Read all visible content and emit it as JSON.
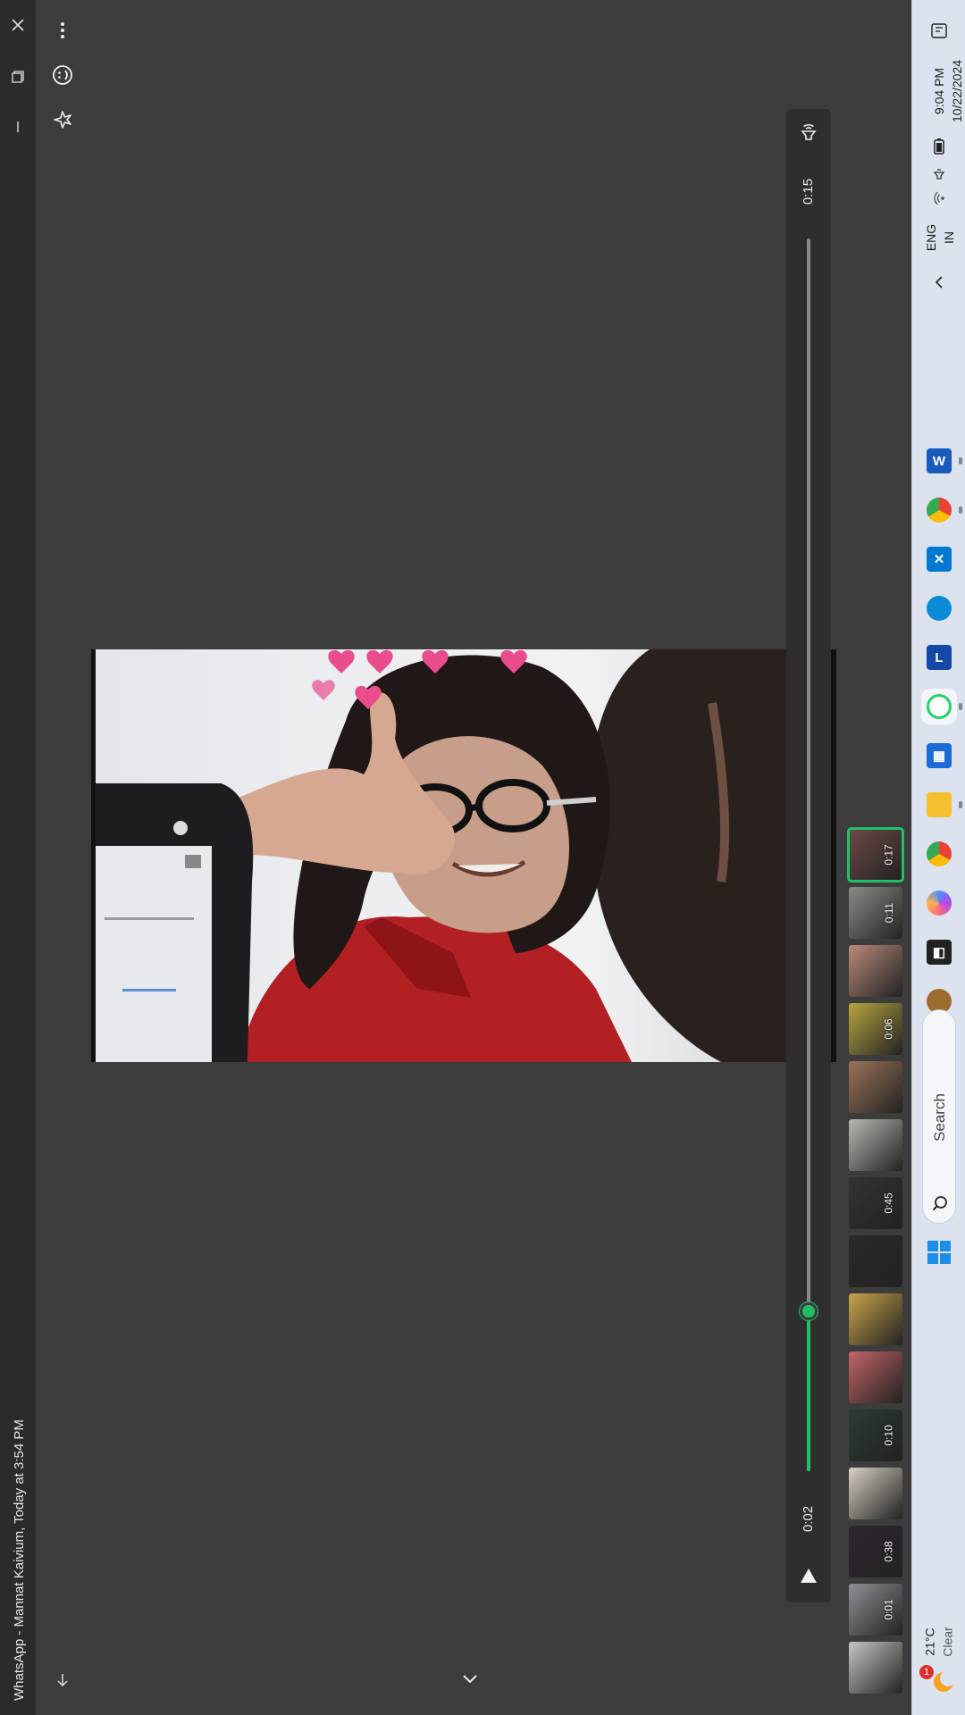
{
  "window": {
    "title": "WhatsApp - Mannat Kaivium, Today at 3:54 PM",
    "controls": {
      "close": "close-icon",
      "restore": "restore-icon",
      "minimize": "minimize-icon"
    }
  },
  "toolbar": {
    "items": [
      {
        "name": "more-options",
        "icon": "more-vertical-icon"
      },
      {
        "name": "react",
        "icon": "emoji-icon"
      },
      {
        "name": "star",
        "icon": "star-icon"
      }
    ],
    "download_icon": "download-icon",
    "collapse_icon": "chevron-down-icon"
  },
  "player": {
    "volume_icon": "volume-icon",
    "duration": "0:15",
    "current_time": "0:02",
    "progress": 0.13,
    "play_icon": "play-icon",
    "accent": "#21c063"
  },
  "thumbnails": [
    {
      "duration": "0:17",
      "selected": true,
      "color": "#6b4a48"
    },
    {
      "duration": "0:11",
      "selected": false,
      "color": "#8a8a86"
    },
    {
      "duration": "",
      "selected": false,
      "color": "#b88a7a"
    },
    {
      "duration": "0:06",
      "selected": false,
      "color": "#b7a640"
    },
    {
      "duration": "",
      "selected": false,
      "color": "#9c7458"
    },
    {
      "duration": "",
      "selected": false,
      "color": "#b7b7b2"
    },
    {
      "duration": "0:45",
      "selected": false,
      "color": "#333335"
    },
    {
      "duration": "",
      "selected": false,
      "color": "#2a2a2a"
    },
    {
      "duration": "",
      "selected": false,
      "color": "#c9a44a"
    },
    {
      "duration": "",
      "selected": false,
      "color": "#c26467"
    },
    {
      "duration": "0:10",
      "selected": false,
      "color": "#2c3a33"
    },
    {
      "duration": "",
      "selected": false,
      "color": "#d6cfc4"
    },
    {
      "duration": "0:38",
      "selected": false,
      "color": "#2f2730"
    },
    {
      "duration": "0:01",
      "selected": false,
      "color": "#8e9094"
    },
    {
      "duration": "",
      "selected": false,
      "color": "#c7c4c2"
    }
  ],
  "taskbar": {
    "time": "9:04 PM",
    "date": "10/22/2024",
    "language": "ENG",
    "region": "IN",
    "search_label": "Search",
    "weather_temp": "21°C",
    "weather_desc": "Clear",
    "notification_count": "1",
    "apps": [
      {
        "name": "word",
        "icon": "word-icon",
        "color": "#185abd",
        "running": true
      },
      {
        "name": "chrome-profile",
        "icon": "chrome-icon",
        "color": "#ea4335",
        "running": true
      },
      {
        "name": "copilot-x",
        "icon": "x-app-icon",
        "color": "#0078d4",
        "running": false
      },
      {
        "name": "edge",
        "icon": "edge-icon",
        "color": "#0c8bd6",
        "running": false
      },
      {
        "name": "l-app",
        "icon": "l-app-icon",
        "color": "#1447a6",
        "running": false
      },
      {
        "name": "whatsapp",
        "icon": "whatsapp-icon",
        "color": "#25d366",
        "running": true
      },
      {
        "name": "store",
        "icon": "store-icon",
        "color": "#1a6ad8",
        "running": false
      },
      {
        "name": "file-explorer",
        "icon": "folder-icon",
        "color": "#f4c02f",
        "running": true
      },
      {
        "name": "chrome",
        "icon": "chrome-icon",
        "color": "#34a853",
        "running": false
      },
      {
        "name": "copilot",
        "icon": "copilot-icon",
        "color": "#b249e6",
        "running": false
      },
      {
        "name": "snipping",
        "icon": "snipping-icon",
        "color": "#222222",
        "running": false
      },
      {
        "name": "widget",
        "icon": "dog-icon",
        "color": "#9b6b2f",
        "running": false
      }
    ]
  }
}
